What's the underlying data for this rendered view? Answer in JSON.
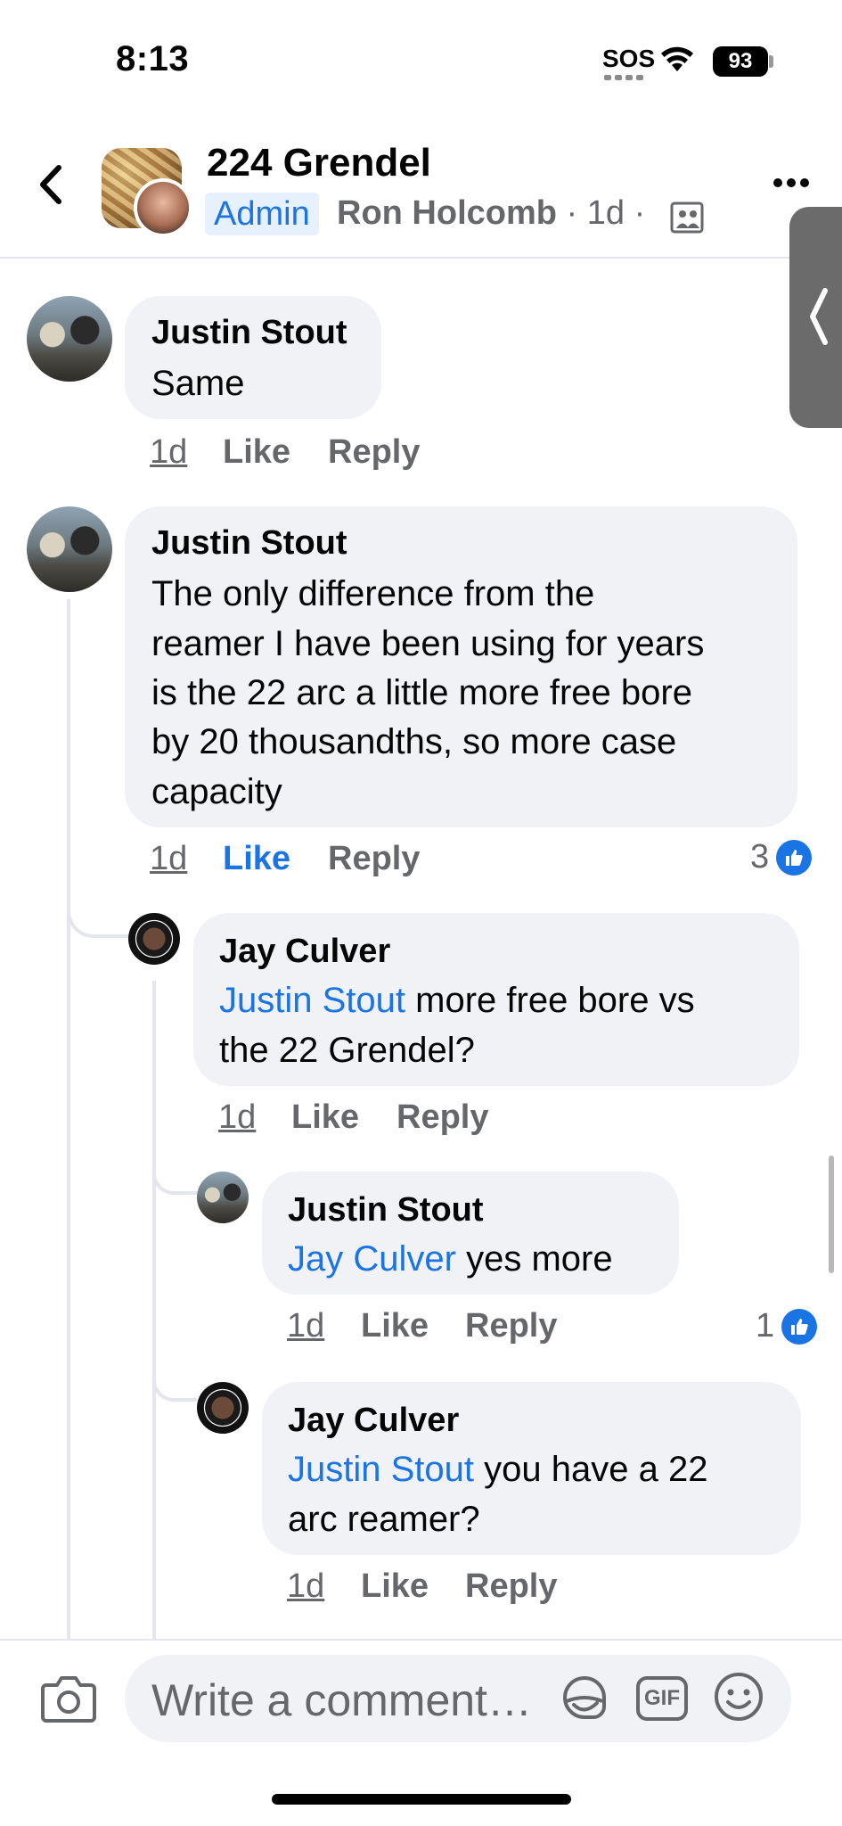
{
  "status_bar": {
    "time": "8:13",
    "sos": "SOS",
    "battery": "93"
  },
  "header": {
    "group_name": "224 Grendel",
    "admin_badge": "Admin",
    "author": "Ron Holcomb",
    "separator": "·",
    "age": "1d",
    "icons": [
      "back-chevron-icon",
      "photo-album-icon",
      "more-options-icon"
    ]
  },
  "comments": [
    {
      "author": "Justin Stout",
      "text": "Same",
      "time": "1d",
      "like": "Like",
      "reply": "Reply"
    },
    {
      "author": "Justin Stout",
      "lines": [
        "The only difference from the",
        "reamer I have been using for years",
        "is the 22 arc a little more free bore",
        "by 20 thousandths, so more case",
        "capacity"
      ],
      "time": "1d",
      "like": "Like",
      "reply": "Reply",
      "reactions": "3"
    }
  ],
  "replies": [
    {
      "author": "Jay Culver",
      "mention": "Justin Stout",
      "text_line1": "more free bore vs",
      "text_line2": "the 22 Grendel?",
      "time": "1d",
      "like": "Like",
      "reply": "Reply"
    },
    {
      "author": "Justin Stout",
      "mention": "Jay Culver",
      "text_line1": "yes more",
      "time": "1d",
      "like": "Like",
      "reply": "Reply",
      "reactions": "1"
    },
    {
      "author": "Jay Culver",
      "mention": "Justin Stout",
      "text_line1": "you have a 22",
      "text_line2": "arc reamer?",
      "time": "1d",
      "like": "Like",
      "reply": "Reply"
    }
  ],
  "composer": {
    "placeholder": "Write a comment…",
    "gif_label": "GIF",
    "icons": [
      "camera-icon",
      "sticker-icon",
      "gif-icon",
      "emoji-icon"
    ]
  },
  "colors": {
    "accent": "#1b74e4",
    "bubble": "#f0f2f5",
    "muted": "#65676b"
  }
}
